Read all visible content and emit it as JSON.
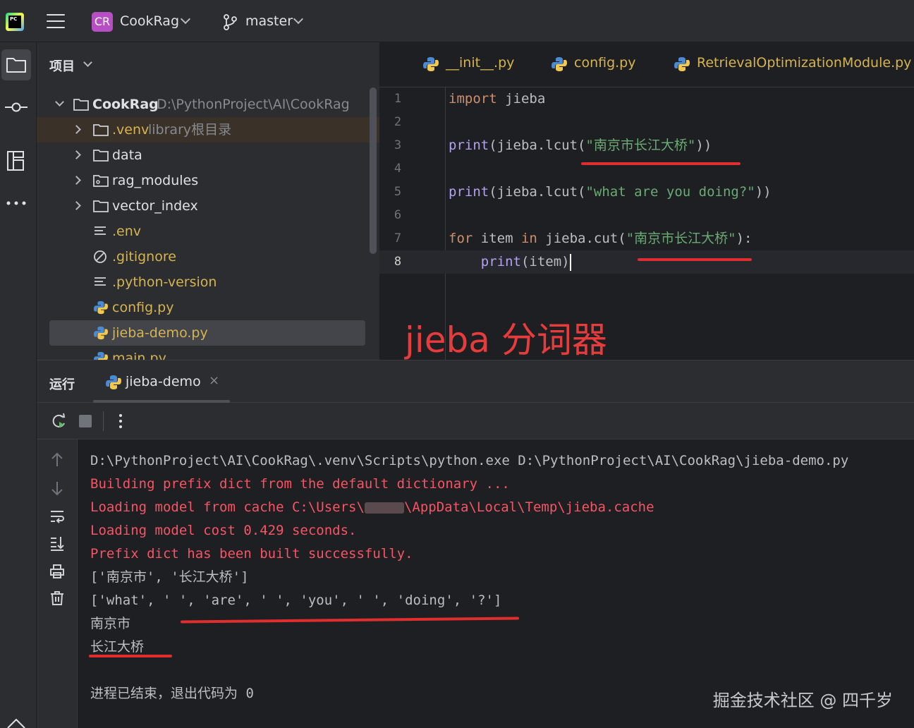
{
  "topbar": {
    "app_logo": "PC",
    "project_badge": "CR",
    "project_name": "CookRag",
    "branch": "master"
  },
  "project_panel": {
    "title": "项目",
    "root": {
      "name": "CookRag",
      "path": "D:\\PythonProject\\AI\\CookRag"
    },
    "items": [
      {
        "name": ".venv",
        "note": "library根目录",
        "icon": "folder-icon"
      },
      {
        "name": "data",
        "icon": "folder-icon"
      },
      {
        "name": "rag_modules",
        "icon": "package-folder-icon"
      },
      {
        "name": "vector_index",
        "icon": "folder-icon"
      },
      {
        "name": ".env",
        "icon": "text-file-icon"
      },
      {
        "name": ".gitignore",
        "icon": "ignore-file-icon"
      },
      {
        "name": ".python-version",
        "icon": "text-file-icon"
      },
      {
        "name": "config.py",
        "icon": "python-file-icon"
      },
      {
        "name": "jieba-demo.py",
        "icon": "python-file-icon"
      },
      {
        "name": "main.py",
        "icon": "python-file-icon"
      }
    ]
  },
  "editor": {
    "tabs": [
      "__init__.py",
      "config.py",
      "RetrievalOptimizationModule.py"
    ],
    "line_numbers": [
      "1",
      "2",
      "3",
      "4",
      "5",
      "6",
      "7",
      "8"
    ],
    "tokens": {
      "import": "import",
      "jieba": " jieba",
      "print": "print",
      "lcut_call": "(jieba.lcut(",
      "close2": "))",
      "str1": "\"南京市长江大桥\"",
      "str2": "\"what are you doing?\"",
      "for": "for",
      "item_space": " item ",
      "in": "in",
      "cut_call": " jieba.cut(",
      "close_colon": "):",
      "indent": "    ",
      "print_args": "(item)"
    },
    "annotation": "jieba 分词器"
  },
  "run_panel": {
    "title": "运行",
    "tab": "jieba-demo",
    "tab_close": "×",
    "output": [
      {
        "text": "D:\\PythonProject\\AI\\CookRag\\.venv\\Scripts\\python.exe D:\\PythonProject\\AI\\CookRag\\jieba-demo.py",
        "kind": "normal"
      },
      {
        "text": "Building prefix dict from the default dictionary ...",
        "kind": "err"
      },
      {
        "text_before": "Loading model from cache C:\\Users\\",
        "text_after": "\\AppData\\Local\\Temp\\jieba.cache",
        "kind": "err"
      },
      {
        "text": "Loading model cost 0.429 seconds.",
        "kind": "err"
      },
      {
        "text": "Prefix dict has been built successfully.",
        "kind": "err"
      },
      {
        "text": "['南京市', '长江大桥']",
        "kind": "normal"
      },
      {
        "text": "['what', ' ', 'are', ' ', 'you', ' ', 'doing', '?']",
        "kind": "normal"
      },
      {
        "text": "南京市",
        "kind": "normal"
      },
      {
        "text": "长江大桥",
        "kind": "normal"
      },
      {
        "text": "进程已结束，退出代码为 0",
        "kind": "normal"
      }
    ]
  },
  "watermark": "掘金技术社区 @ 四千岁",
  "colors": {
    "annotation_red": "#e83b3b",
    "error_text": "#f75464",
    "keyword": "#cf8e6d",
    "function": "#b6a0f0",
    "string": "#6aab73",
    "tab_modified": "#d6b450"
  }
}
